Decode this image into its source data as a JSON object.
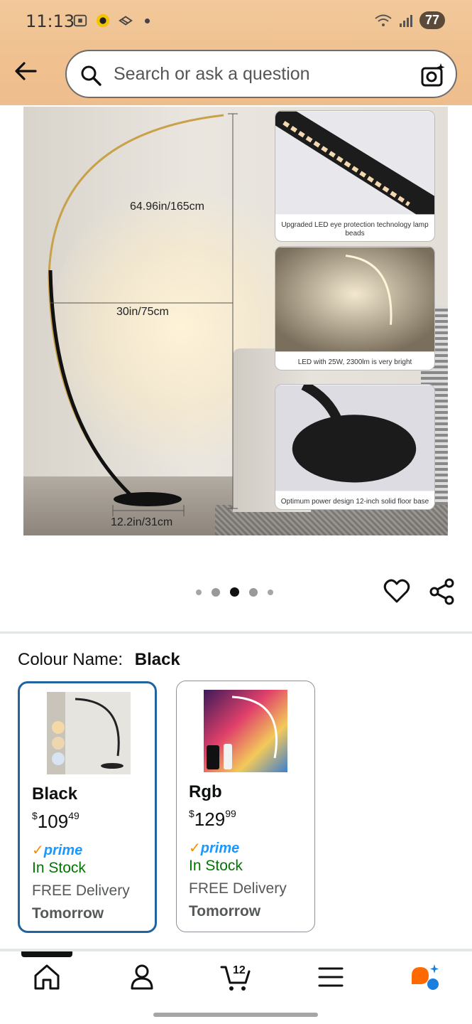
{
  "status_bar": {
    "time": "11:13",
    "battery": "77",
    "icons": [
      "screenshot-icon",
      "app-icon",
      "layers-icon",
      "dot-icon",
      "wifi-icon",
      "signal-icon"
    ]
  },
  "header": {
    "back_icon": "back-arrow-icon",
    "search_placeholder": "Search or ask a question",
    "search_icon": "search-icon",
    "camera_icon": "camera-icon"
  },
  "product_image": {
    "height_label": "64.96in/165cm",
    "width_label": "30in/75cm",
    "base_label": "12.2in/31cm",
    "callouts": [
      {
        "caption": "Upgraded LED eye protection technology lamp beads"
      },
      {
        "caption": "LED with 25W, 2300lm is very bright"
      },
      {
        "caption": "Optimum power design 12-inch solid floor base"
      }
    ],
    "pager": {
      "count": 5,
      "active_index": 2
    }
  },
  "actions": {
    "heart_icon": "heart-icon",
    "share_icon": "share-icon"
  },
  "colour": {
    "label": "Colour Name:",
    "selected": "Black",
    "options": [
      {
        "name": "Black",
        "currency": "$",
        "price_whole": "109",
        "price_fraction": "49",
        "prime": "prime",
        "stock": "In Stock",
        "delivery": "FREE Delivery",
        "when": "Tomorrow"
      },
      {
        "name": "Rgb",
        "currency": "$",
        "price_whole": "129",
        "price_fraction": "99",
        "prime": "prime",
        "stock": "In Stock",
        "delivery": "FREE Delivery",
        "when": "Tomorrow"
      }
    ]
  },
  "bottom_nav": {
    "items": [
      "home-icon",
      "account-icon",
      "cart-icon",
      "menu-icon",
      "ai-assistant-icon"
    ],
    "cart_count": "12"
  },
  "colors": {
    "header_bg": "#f0c08f",
    "selected_border": "#2162a1",
    "prime_blue": "#1a98ff",
    "stock_green": "#007600"
  }
}
